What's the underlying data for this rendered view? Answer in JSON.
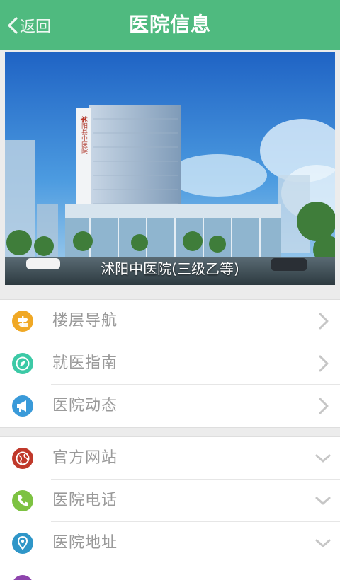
{
  "header": {
    "back_label": "返回",
    "title": "医院信息"
  },
  "banner": {
    "caption": "沭阳中医院(三级乙等)",
    "building_sign": "沭阳县中医院"
  },
  "menu_group_1": [
    {
      "label": "楼层导航",
      "icon": "signpost-icon",
      "color": "#f0a825",
      "indicator": "chevron-right"
    },
    {
      "label": "就医指南",
      "icon": "compass-icon",
      "color": "#3cc9a6",
      "indicator": "chevron-right"
    },
    {
      "label": "医院动态",
      "icon": "megaphone-icon",
      "color": "#3a9ad9",
      "indicator": "chevron-right"
    }
  ],
  "menu_group_2": [
    {
      "label": "官方网站",
      "icon": "globe-icon",
      "color": "#c0392b",
      "indicator": "chevron-down"
    },
    {
      "label": "医院电话",
      "icon": "phone-icon",
      "color": "#7dc242",
      "indicator": "chevron-down"
    },
    {
      "label": "医院地址",
      "icon": "location-pin-icon",
      "color": "#2f96c8",
      "indicator": "chevron-down"
    },
    {
      "label": "",
      "icon": "partial-icon",
      "color": "#8e44ad",
      "indicator": "chevron-down"
    }
  ],
  "colors": {
    "header_bg": "#4fba7f",
    "label_text": "#9a9a9a",
    "page_bg": "#ececec"
  }
}
